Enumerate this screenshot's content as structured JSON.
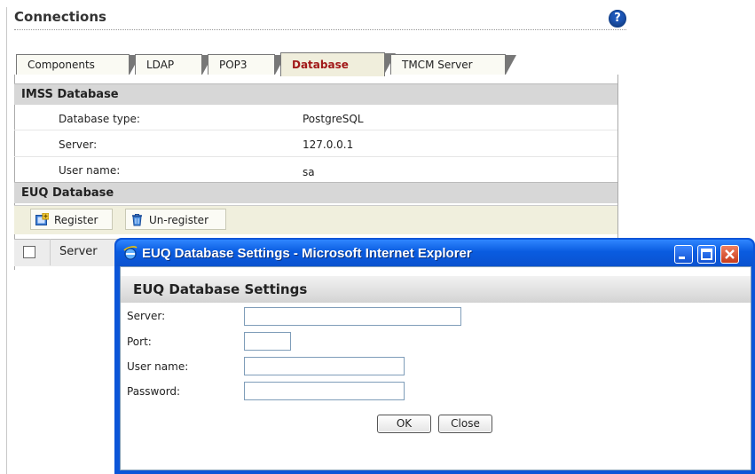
{
  "page": {
    "title": "Connections"
  },
  "tabs": [
    {
      "label": "Components"
    },
    {
      "label": "LDAP"
    },
    {
      "label": "POP3"
    },
    {
      "label": "Database"
    },
    {
      "label": "TMCM Server"
    }
  ],
  "imss": {
    "header": "IMSS Database",
    "rows": [
      {
        "label": "Database type:",
        "value": "PostgreSQL"
      },
      {
        "label": "Server:",
        "value": "127.0.0.1"
      },
      {
        "label": "User name:",
        "value": "sa"
      }
    ]
  },
  "euq": {
    "header": "EUQ Database",
    "register_label": "Register",
    "unregister_label": "Un-register",
    "table": {
      "columns": [
        "Server"
      ]
    }
  },
  "dialog": {
    "window_title": "EUQ Database Settings - Microsoft Internet Explorer",
    "heading": "EUQ Database Settings",
    "fields": [
      {
        "label": "Server:",
        "value": ""
      },
      {
        "label": "Port:",
        "value": ""
      },
      {
        "label": "User name:",
        "value": ""
      },
      {
        "label": "Password:",
        "value": ""
      }
    ],
    "ok_label": "OK",
    "close_label": "Close"
  },
  "colors": {
    "active_tab_text": "#a11818",
    "section_bg": "#d7d7d7",
    "titlebar_blue": "#0b55d8"
  }
}
